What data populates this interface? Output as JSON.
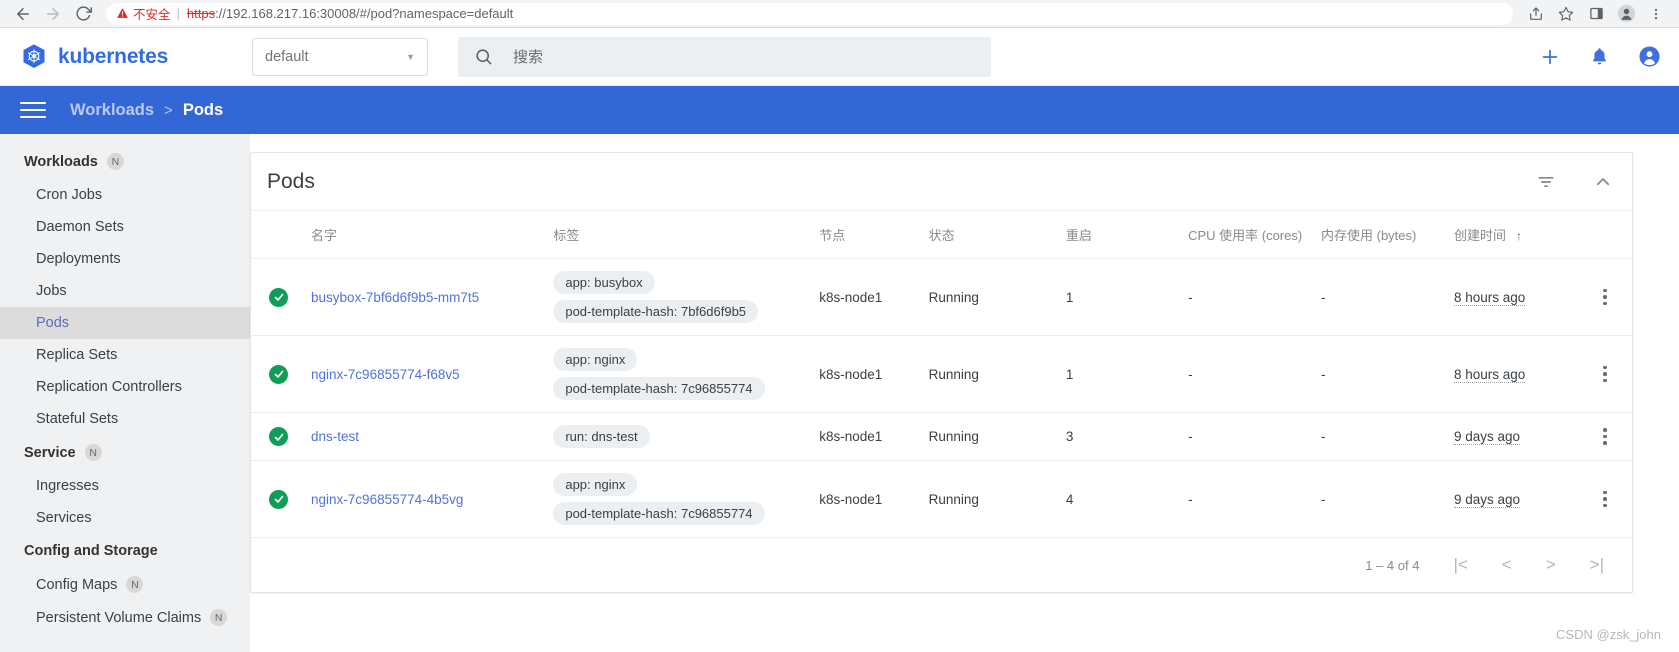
{
  "browser": {
    "back_icon": "arrow-left-icon",
    "forward_icon": "arrow-right-icon",
    "reload_icon": "reload-icon",
    "security_warning": "不安全",
    "url_scheme": "https",
    "url_rest": "://192.168.217.16:30008/#/pod?namespace=default",
    "share_icon": "share-icon",
    "bookmark_icon": "star-icon",
    "sidepanel_icon": "side-panel-icon",
    "profile_icon": "profile-avatar-icon",
    "menu_icon": "three-dot-menu-icon"
  },
  "header": {
    "logo_label": "kubernetes",
    "namespace_value": "default",
    "search_placeholder": "搜索",
    "actions": [
      {
        "name": "create-button",
        "glyph": "+"
      },
      {
        "name": "notifications-button",
        "glyph": "bell"
      },
      {
        "name": "account-button",
        "glyph": "account"
      }
    ]
  },
  "breadcrumb": {
    "menu_icon": "hamburger-menu-icon",
    "parent": "Workloads",
    "separator": ">",
    "current": "Pods"
  },
  "sidebar": {
    "groups": [
      {
        "title": "Workloads",
        "badge": "N",
        "items": [
          {
            "label": "Cron Jobs",
            "active": false,
            "badge": ""
          },
          {
            "label": "Daemon Sets",
            "active": false,
            "badge": ""
          },
          {
            "label": "Deployments",
            "active": false,
            "badge": ""
          },
          {
            "label": "Jobs",
            "active": false,
            "badge": ""
          },
          {
            "label": "Pods",
            "active": true,
            "badge": ""
          },
          {
            "label": "Replica Sets",
            "active": false,
            "badge": ""
          },
          {
            "label": "Replication Controllers",
            "active": false,
            "badge": ""
          },
          {
            "label": "Stateful Sets",
            "active": false,
            "badge": ""
          }
        ]
      },
      {
        "title": "Service",
        "badge": "N",
        "items": [
          {
            "label": "Ingresses",
            "active": false,
            "badge": ""
          },
          {
            "label": "Services",
            "active": false,
            "badge": ""
          }
        ]
      },
      {
        "title": "Config and Storage",
        "badge": "",
        "items": [
          {
            "label": "Config Maps",
            "active": false,
            "badge": "N"
          },
          {
            "label": "Persistent Volume Claims",
            "active": false,
            "badge": "N"
          }
        ]
      }
    ]
  },
  "card": {
    "title": "Pods",
    "filter_icon": "filter-icon",
    "collapse_icon": "chevron-up-icon",
    "columns": [
      "名字",
      "标签",
      "节点",
      "状态",
      "重启",
      "CPU 使用率 (cores)",
      "内存使用 (bytes)",
      "创建时间"
    ],
    "sort_column": "创建时间",
    "sort_arrow": "↑",
    "rows": [
      {
        "status_icon": "success-check-icon",
        "name": "busybox-7bf6d6f9b5-mm7t5",
        "labels": [
          "app: busybox",
          "pod-template-hash: 7bf6d6f9b5"
        ],
        "node": "k8s-node1",
        "state": "Running",
        "restarts": "1",
        "cpu": "-",
        "memory": "-",
        "created": "8 hours ago"
      },
      {
        "status_icon": "success-check-icon",
        "name": "nginx-7c96855774-f68v5",
        "labels": [
          "app: nginx",
          "pod-template-hash: 7c96855774"
        ],
        "node": "k8s-node1",
        "state": "Running",
        "restarts": "1",
        "cpu": "-",
        "memory": "-",
        "created": "8 hours ago"
      },
      {
        "status_icon": "success-check-icon",
        "name": "dns-test",
        "labels": [
          "run: dns-test"
        ],
        "node": "k8s-node1",
        "state": "Running",
        "restarts": "3",
        "cpu": "-",
        "memory": "-",
        "created": "9 days ago"
      },
      {
        "status_icon": "success-check-icon",
        "name": "nginx-7c96855774-4b5vg",
        "labels": [
          "app: nginx",
          "pod-template-hash: 7c96855774"
        ],
        "node": "k8s-node1",
        "state": "Running",
        "restarts": "4",
        "cpu": "-",
        "memory": "-",
        "created": "9 days ago"
      }
    ],
    "pagination": {
      "range_label": "1 – 4 of 4",
      "first_glyph": "|<",
      "prev_glyph": "<",
      "next_glyph": ">",
      "last_glyph": ">|"
    }
  },
  "watermark": "CSDN @zsk_john",
  "colors": {
    "brand_blue": "#326ce5",
    "breadcrumb_blue": "#3367d6",
    "success_green": "#0f9d58",
    "link_blue": "#4f73d8",
    "warning_red": "#d93025"
  }
}
